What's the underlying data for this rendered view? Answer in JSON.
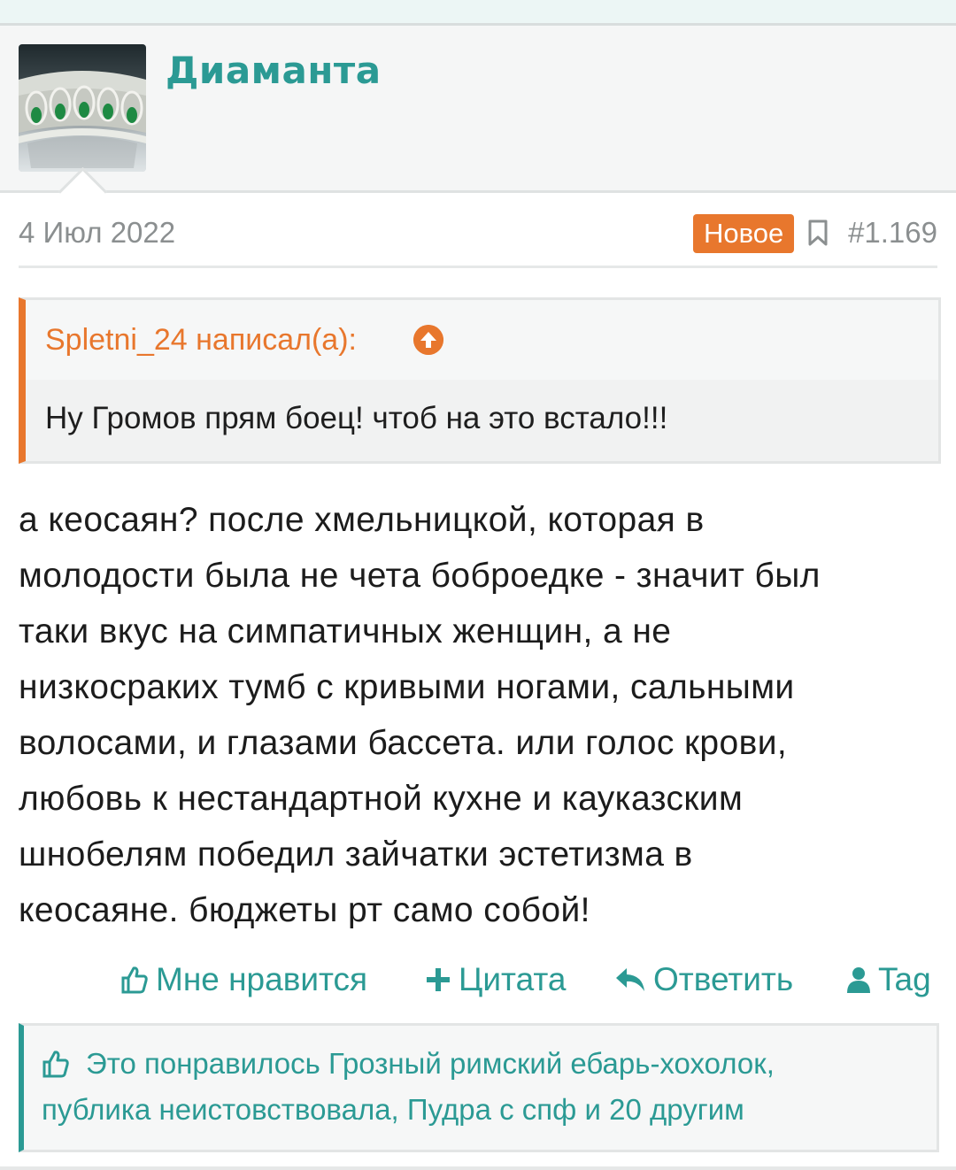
{
  "post": {
    "username": "Диаманта",
    "date": "4 Июл 2022",
    "badge": "Новое",
    "post_number": "#1.169",
    "quote": {
      "author_line": "Spletni_24 написал(а):",
      "text": "Ну Громов прям боец! чтоб на это встало!!!"
    },
    "body_lines": [
      "а кеосаян? после хмельницкой, которая в",
      "молодости была не чета боброедке - значит был",
      "таки вкус на симпатичных женщин, а не",
      "низкосраких тумб с кривыми ногами, сальными",
      "волосами, и глазами бассета. или голос крови,",
      "любовь к нестандартной кухне и кауказским",
      "шнобелям победил зайчатки эстетизма в",
      "кеосаяне. бюджеты рт само собой!"
    ]
  },
  "actions": {
    "like": "Мне нравится",
    "quote": "Цитата",
    "reply": "Ответить",
    "tag": "Tag"
  },
  "likes": {
    "line1": "Это понравилось Грозный римский ебарь-хохолок,",
    "line2": "публика неистовствовала, Пудра с спф и 20 другим"
  },
  "icons": {
    "avatar": "tiara-avatar-image",
    "bookmark": "bookmark-icon",
    "quote_up": "arrow-up-circle-icon",
    "like": "thumbs-up-icon",
    "quote": "plus-icon",
    "reply": "reply-icon",
    "tag": "user-icon"
  },
  "colors": {
    "accent": "#2b9a94",
    "orange": "#e8772d",
    "text": "#1c1c1c",
    "muted": "#8b8f90"
  }
}
